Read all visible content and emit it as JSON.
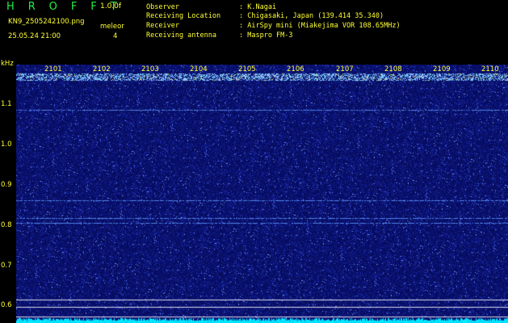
{
  "header": {
    "app_title": "H R O F F T",
    "version": "1.0.0f",
    "file_name": "KN9_2505242100.png",
    "timestamp": "25.05.24 21:00",
    "mode_label": "meleor",
    "mode_value": "4"
  },
  "info": [
    {
      "label": "Observer",
      "value": ": K.Nagai"
    },
    {
      "label": "Receiving Location",
      "value": ": Chigasaki, Japan (139.414 35.340)"
    },
    {
      "label": "Receiver",
      "value": ": AirSpy mini (Miakejima VOR 108.65MHz)"
    },
    {
      "label": "Receiving antenna",
      "value": ": Maspro FM-3"
    }
  ],
  "axis": {
    "y_unit": "kHz",
    "y_ticks": [
      "1.1",
      "1.0",
      "0.9",
      "0.8",
      "0.7",
      "0.6"
    ],
    "x_ticks": [
      "2101",
      "2102",
      "2103",
      "2104",
      "2105",
      "2106",
      "2107",
      "2108",
      "2109",
      "2110"
    ]
  },
  "colors": {
    "text": "#ffff33",
    "title": "#22ee44",
    "background": "#000000",
    "noise": "#1a2a9a",
    "signal": "#7fd4ff",
    "baseline": "#00e5ff"
  }
}
